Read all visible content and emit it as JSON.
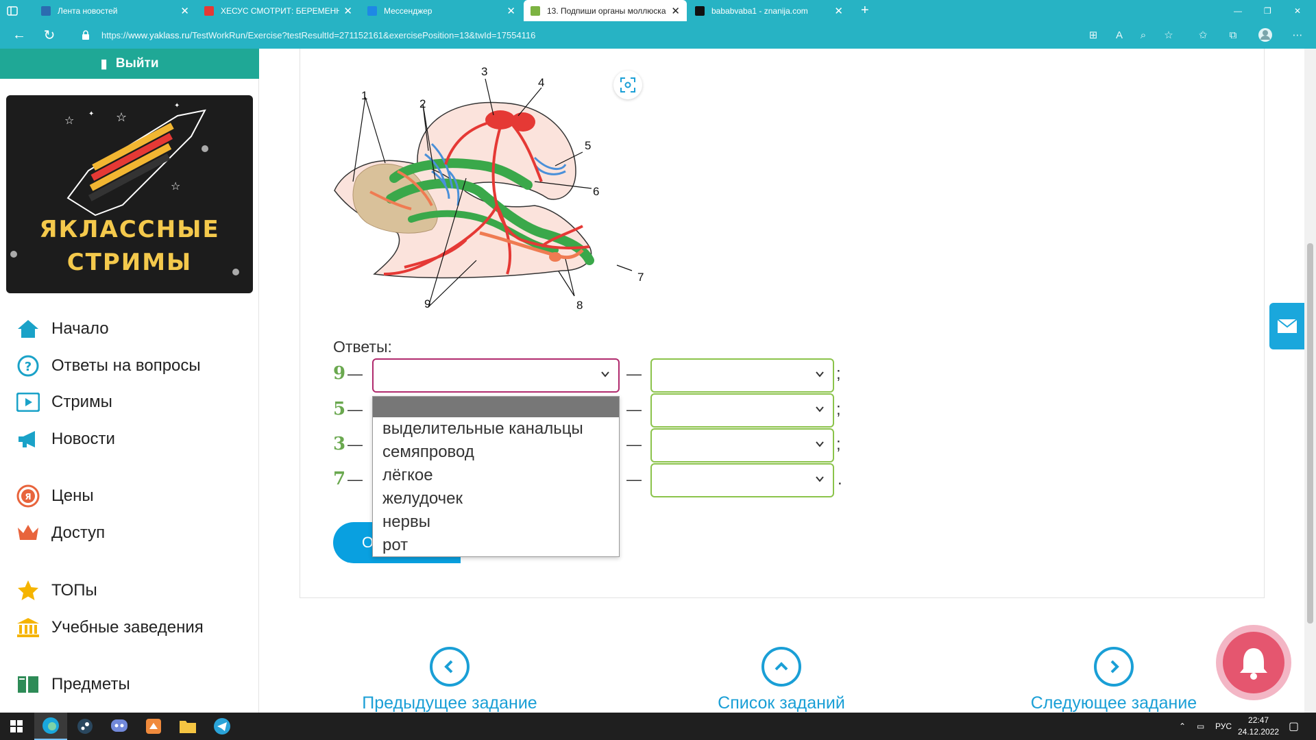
{
  "browser": {
    "tabs": [
      {
        "title": "Лента новостей",
        "favicon_color": "#2b6cb0"
      },
      {
        "title": "ХЕСУС СМОТРИТ: БЕРЕМЕННА",
        "favicon_color": "#e53935"
      },
      {
        "title": "Мессенджер",
        "favicon_color": "#1e88e5"
      },
      {
        "title": "13. Подпиши органы моллюска",
        "favicon_color": "#7cb342"
      },
      {
        "title": "bababvaba1 - znanija.com",
        "favicon_color": "#111111"
      }
    ],
    "active_tab": 3,
    "url_prefix": "https://",
    "url_domain": "www.yaklass.ru",
    "url_rest": "/TestWorkRun/Exercise?testResultId=271152161&exercisePosition=13&twId=17554116"
  },
  "sidebar": {
    "logout_label": "Выйти",
    "promo": {
      "line1": "ЯКЛАССНЫЕ",
      "line2": "СТРИМЫ"
    },
    "nav": [
      {
        "label": "Начало",
        "icon": "home-icon"
      },
      {
        "label": "Ответы на вопросы",
        "icon": "question-icon"
      },
      {
        "label": "Стримы",
        "icon": "play-icon"
      },
      {
        "label": "Новости",
        "icon": "megaphone-icon"
      },
      {
        "label": "Цены",
        "icon": "price-icon"
      },
      {
        "label": "Доступ",
        "icon": "crown-icon"
      },
      {
        "label": "ТОПы",
        "icon": "star-icon"
      },
      {
        "label": "Учебные заведения",
        "icon": "institution-icon"
      },
      {
        "label": "Предметы",
        "icon": "book-icon"
      }
    ]
  },
  "diagram": {
    "labels": [
      "1",
      "2",
      "3",
      "4",
      "5",
      "6",
      "7",
      "8",
      "9"
    ]
  },
  "exercise": {
    "answers_label": "Ответы:",
    "rows": [
      {
        "num": "9",
        "end": ";"
      },
      {
        "num": "5",
        "end": ";"
      },
      {
        "num": "3",
        "end": ";"
      },
      {
        "num": "7",
        "end": "."
      }
    ],
    "dash": "—",
    "dropdown_options": [
      "выделительные канальцы",
      "семяпровод",
      "лёгкое",
      "желудочек",
      "нервы",
      "рот"
    ],
    "check_button": "О"
  },
  "pager": {
    "prev": "Предыдущее задание",
    "list": "Список заданий",
    "next": "Следующее задание"
  },
  "taskbar": {
    "lang": "РУС",
    "time": "22:47",
    "date": "24.12.2022"
  },
  "colors": {
    "brand": "#27b3c4",
    "accent_blue": "#1a9fd6",
    "answer_green": "#8bc34a"
  }
}
